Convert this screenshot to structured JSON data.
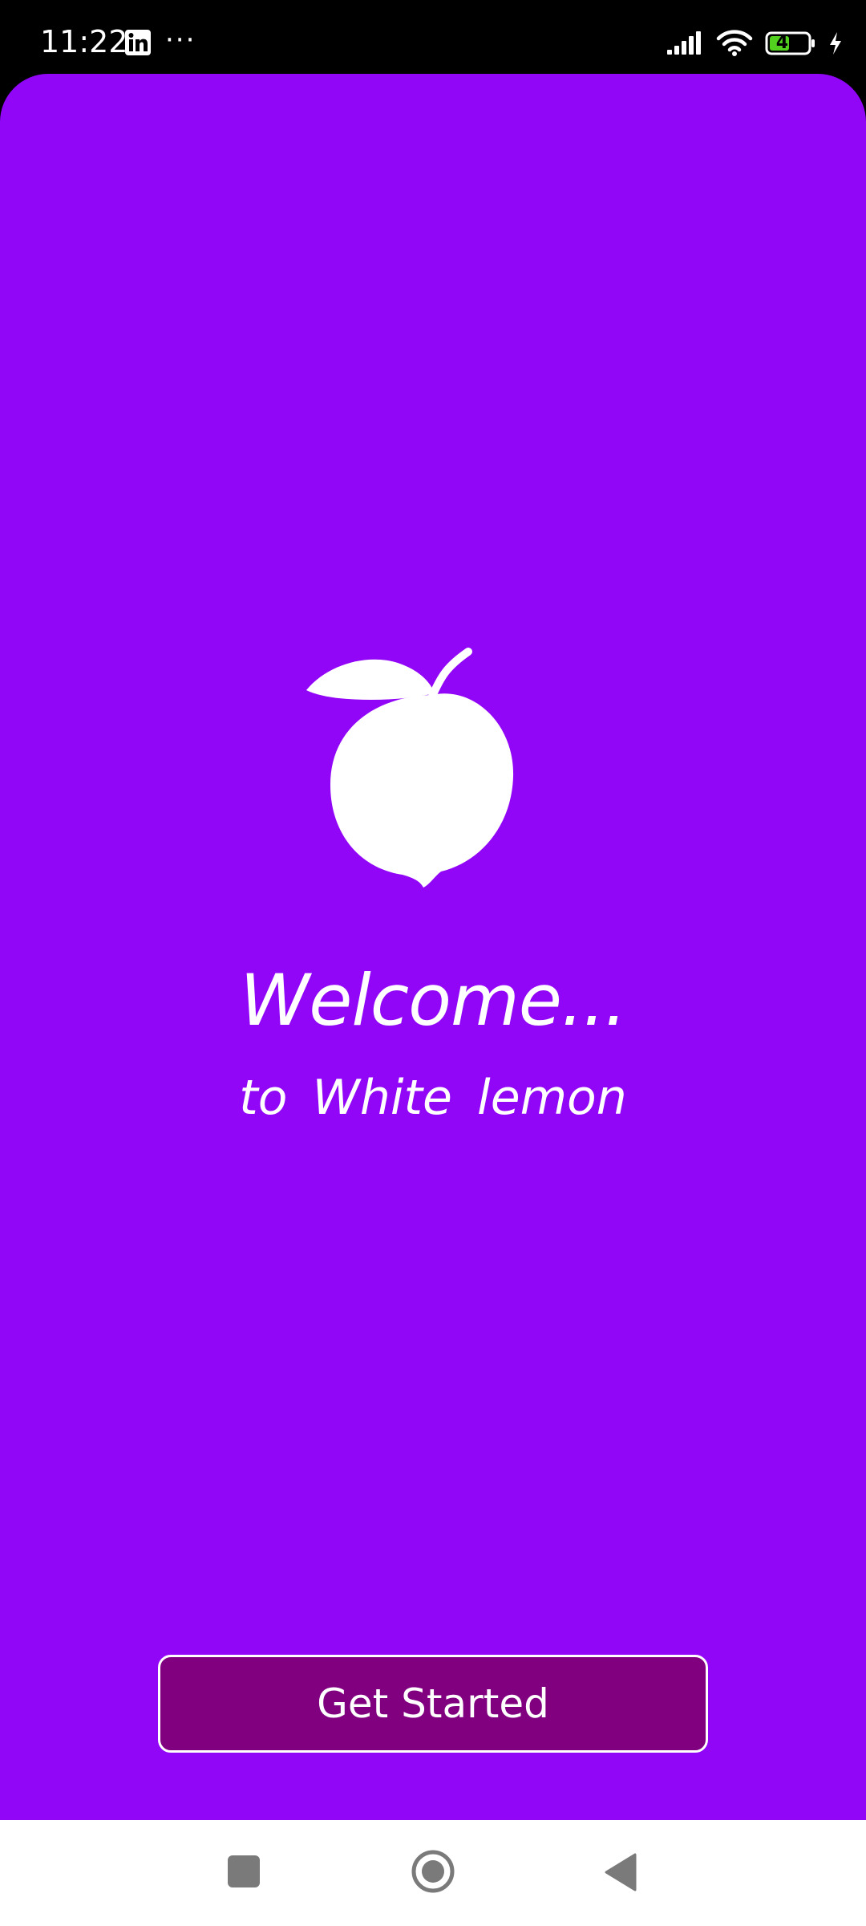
{
  "status_bar": {
    "time": "11:22",
    "notification_icons": [
      "linkedin-icon",
      "more-dots-icon"
    ],
    "more_indicator": "···",
    "battery_level": "49",
    "system_icons": [
      "signal-icon",
      "wifi-icon",
      "battery-icon",
      "charging-icon"
    ]
  },
  "welcome": {
    "logo_icon": "lemon-icon",
    "title": "Welcome...",
    "subtitle": "to  White lemon"
  },
  "actions": {
    "get_started_label": "Get Started"
  },
  "nav_bar": {
    "icons": [
      "recents-square-icon",
      "home-circle-icon",
      "back-triangle-icon"
    ]
  },
  "colors": {
    "background": "#9206f7",
    "button_fill": "#800080",
    "button_border": "#ffffff",
    "text": "#ffffff",
    "status_bar": "#000000",
    "nav_bar": "#ffffff"
  }
}
